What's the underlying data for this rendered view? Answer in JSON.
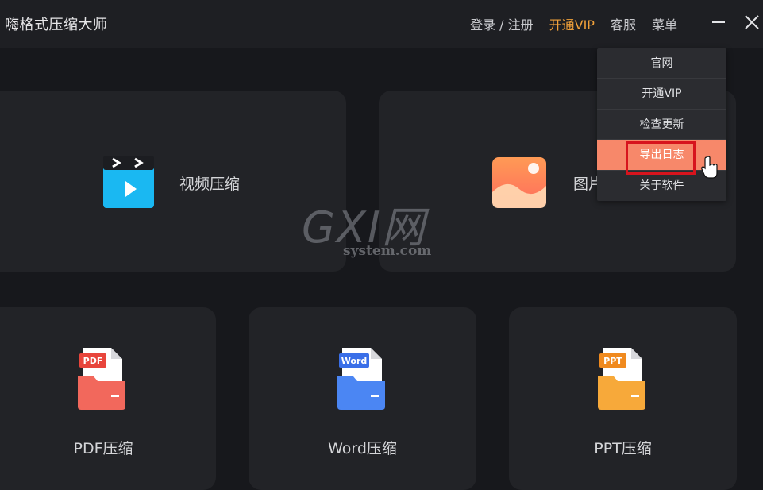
{
  "app": {
    "title": "嗨格式压缩大师"
  },
  "nav": {
    "login": "登录 / 注册",
    "vip": "开通VIP",
    "service": "客服",
    "menu": "菜单"
  },
  "dropdown": {
    "items": [
      "官网",
      "开通VIP",
      "检查更新",
      "导出日志",
      "关于软件"
    ],
    "active_index": 3
  },
  "cards": {
    "video": "视频压缩",
    "image": "图片",
    "pdf": "PDF压缩",
    "word": "Word压缩",
    "ppt": "PPT压缩"
  },
  "file_badges": {
    "pdf": "PDF",
    "word": "Word",
    "ppt": "PPT"
  },
  "watermark": {
    "brand": "GXI网",
    "domain": "system.com"
  },
  "colors": {
    "vip": "#f0a03a",
    "active_menu": "#f7886a",
    "highlight": "#d7141d"
  }
}
